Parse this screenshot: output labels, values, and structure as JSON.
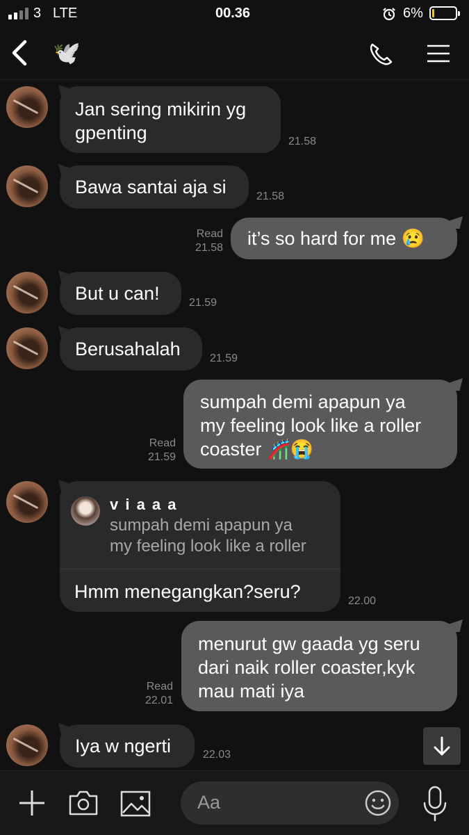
{
  "status_bar": {
    "carrier": "3",
    "network": "LTE",
    "time": "00.36",
    "battery": "6%",
    "battery_level": 0.06
  },
  "header": {
    "contact_icon": "dove-emoji",
    "contact_emoji": "🕊️"
  },
  "messages": [
    {
      "dir": "in",
      "lines": [
        "Jan sering mikirin yg",
        "gpenting"
      ],
      "time": "21.58"
    },
    {
      "dir": "in",
      "lines": [
        "Bawa santai aja si"
      ],
      "time": "21.58"
    },
    {
      "dir": "out",
      "lines": [
        "it’s so hard for me 😢"
      ],
      "read": "Read",
      "time": "21.58"
    },
    {
      "dir": "in",
      "lines": [
        "But u can!"
      ],
      "time": "21.59"
    },
    {
      "dir": "in",
      "lines": [
        "Berusahalah"
      ],
      "time": "21.59"
    },
    {
      "dir": "out",
      "lines": [
        "sumpah demi apapun ya",
        "my feeling look like a roller",
        "coaster 🎢😭"
      ],
      "read": "Read",
      "time": "21.59"
    },
    {
      "dir": "in",
      "reply_name": "v i a a a",
      "reply_lines": [
        "sumpah demi apapun ya",
        "my feeling look like a roller"
      ],
      "lines": [
        "Hmm menegangkan?seru?"
      ],
      "time": "22.00"
    },
    {
      "dir": "out",
      "lines": [
        "menurut gw gaada yg seru",
        "dari naik roller coaster,kyk",
        "mau mati iya"
      ],
      "read": "Read",
      "time": "22.01"
    },
    {
      "dir": "in",
      "lines": [
        "Iya w ngerti"
      ],
      "time": "22.03"
    }
  ],
  "input": {
    "placeholder": "Aa"
  }
}
